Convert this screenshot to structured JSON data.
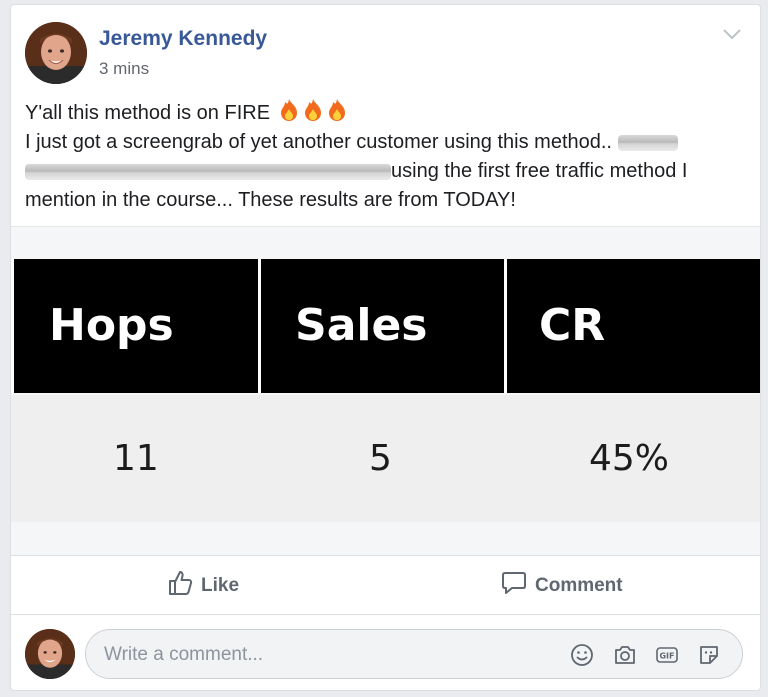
{
  "post": {
    "author": "Jeremy Kennedy",
    "timestamp": "3 mins",
    "text_line1": "Y'all this method is on FIRE",
    "text_line2": "I just got a screengrab of yet another customer using this method..",
    "text_line3": "using the first free traffic method I",
    "text_line4": "mention in the course... These results are from TODAY!"
  },
  "stats_table": {
    "headers": [
      "Hops",
      "Sales",
      "CR"
    ],
    "values": [
      "11",
      "5",
      "45%"
    ]
  },
  "actions": {
    "like_label": "Like",
    "comment_label": "Comment"
  },
  "comment_box": {
    "placeholder": "Write a comment..."
  },
  "colors": {
    "author_link": "#385898",
    "action_text": "#606770",
    "table_header_bg": "#000000"
  },
  "icons": [
    "chevron-down-icon",
    "fire-emoji-icon",
    "like-thumb-icon",
    "comment-bubble-icon",
    "smiley-icon",
    "camera-icon",
    "gif-icon",
    "sticker-icon"
  ]
}
